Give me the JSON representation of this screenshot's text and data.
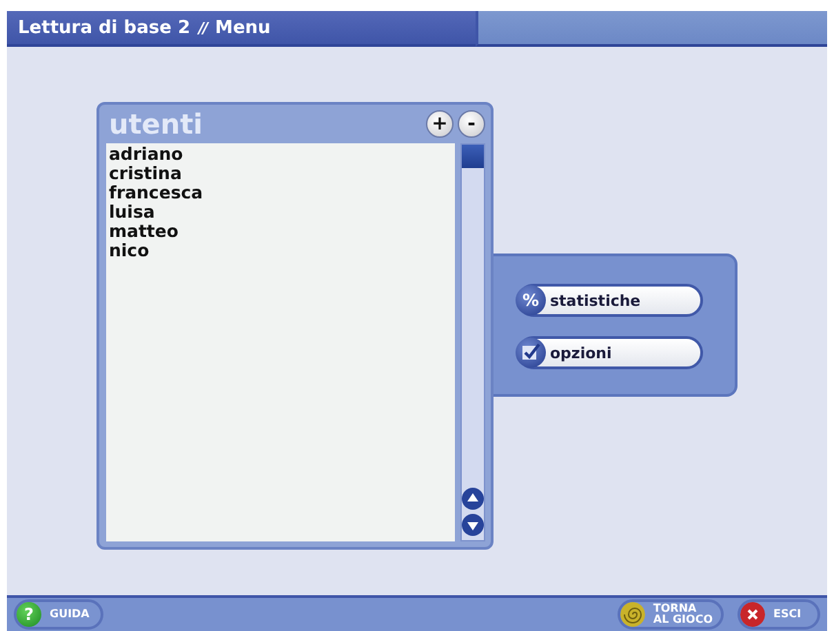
{
  "window": {
    "title": "Lettura di base 2",
    "separator": "//",
    "section": "Menu"
  },
  "users_panel": {
    "title": "utenti",
    "add_button": "+",
    "remove_button": "-",
    "users": [
      {
        "name": "adriano",
        "selected": false
      },
      {
        "name": "cristina",
        "selected": false
      },
      {
        "name": "francesca",
        "selected": false
      },
      {
        "name": "luisa",
        "selected": false
      },
      {
        "name": "matteo",
        "selected": false
      },
      {
        "name": "nico",
        "selected": false
      }
    ]
  },
  "actions": [
    {
      "kind": "percent",
      "icon_text": "%",
      "label": "statistiche"
    },
    {
      "kind": "check",
      "label": "opzioni"
    }
  ],
  "bottom_bar": {
    "help": {
      "icon_text": "?",
      "label": "GUIDA"
    },
    "back": {
      "label_lines": [
        "TORNA",
        "AL GIOCO"
      ]
    },
    "exit": {
      "label": "ESCI"
    }
  }
}
